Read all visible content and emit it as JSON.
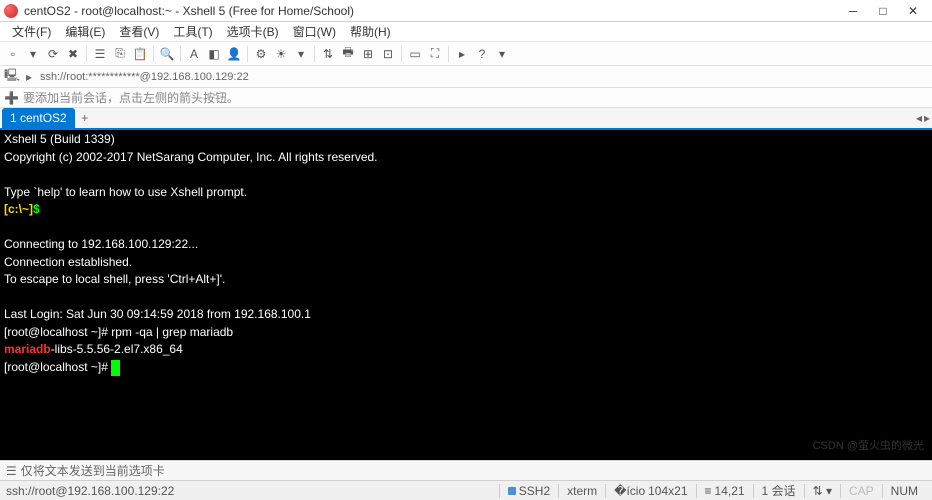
{
  "window": {
    "title": "centOS2 - root@localhost:~ - Xshell 5 (Free for Home/School)"
  },
  "menu": {
    "items": [
      "文件(F)",
      "编辑(E)",
      "查看(V)",
      "工具(T)",
      "选项卡(B)",
      "窗口(W)",
      "帮助(H)"
    ]
  },
  "addressbar": {
    "url": "ssh://root:************@192.168.100.129:22"
  },
  "hintbar": {
    "text": "要添加当前会话，点击左侧的箭头按钮。"
  },
  "tab": {
    "label": "1 centOS2"
  },
  "terminal": {
    "banner_line1": "Xshell 5 (Build 1339)",
    "banner_line2": "Copyright (c) 2002-2017 NetSarang Computer, Inc. All rights reserved.",
    "help_line": "Type `help' to learn how to use Xshell prompt.",
    "local_prompt_host": "[c:\\~]",
    "local_prompt_sym": "$",
    "connecting": "Connecting to 192.168.100.129:22...",
    "established": "Connection established.",
    "escape": "To escape to local shell, press 'Ctrl+Alt+]'.",
    "last_login": "Last Login: Sat Jun 30 09:14:59 2018 from 192.168.100.1",
    "prompt1": "[root@localhost ~]# ",
    "cmd1": "rpm -qa | grep mariadb",
    "match_hi": "mariadb",
    "match_rest": "-libs-5.5.56-2.el7.x86_64",
    "prompt2": "[root@localhost ~]# "
  },
  "footer": {
    "text": "仅将文本发送到当前选项卡"
  },
  "status": {
    "left": "ssh://root@192.168.100.129:22",
    "ssh": "SSH2",
    "term": "xterm",
    "size": "104x21",
    "pos": "14,21",
    "session": "1 会话",
    "cap": "CAP",
    "num": "NUM"
  },
  "watermark": "CSDN @萤火虫的微光"
}
